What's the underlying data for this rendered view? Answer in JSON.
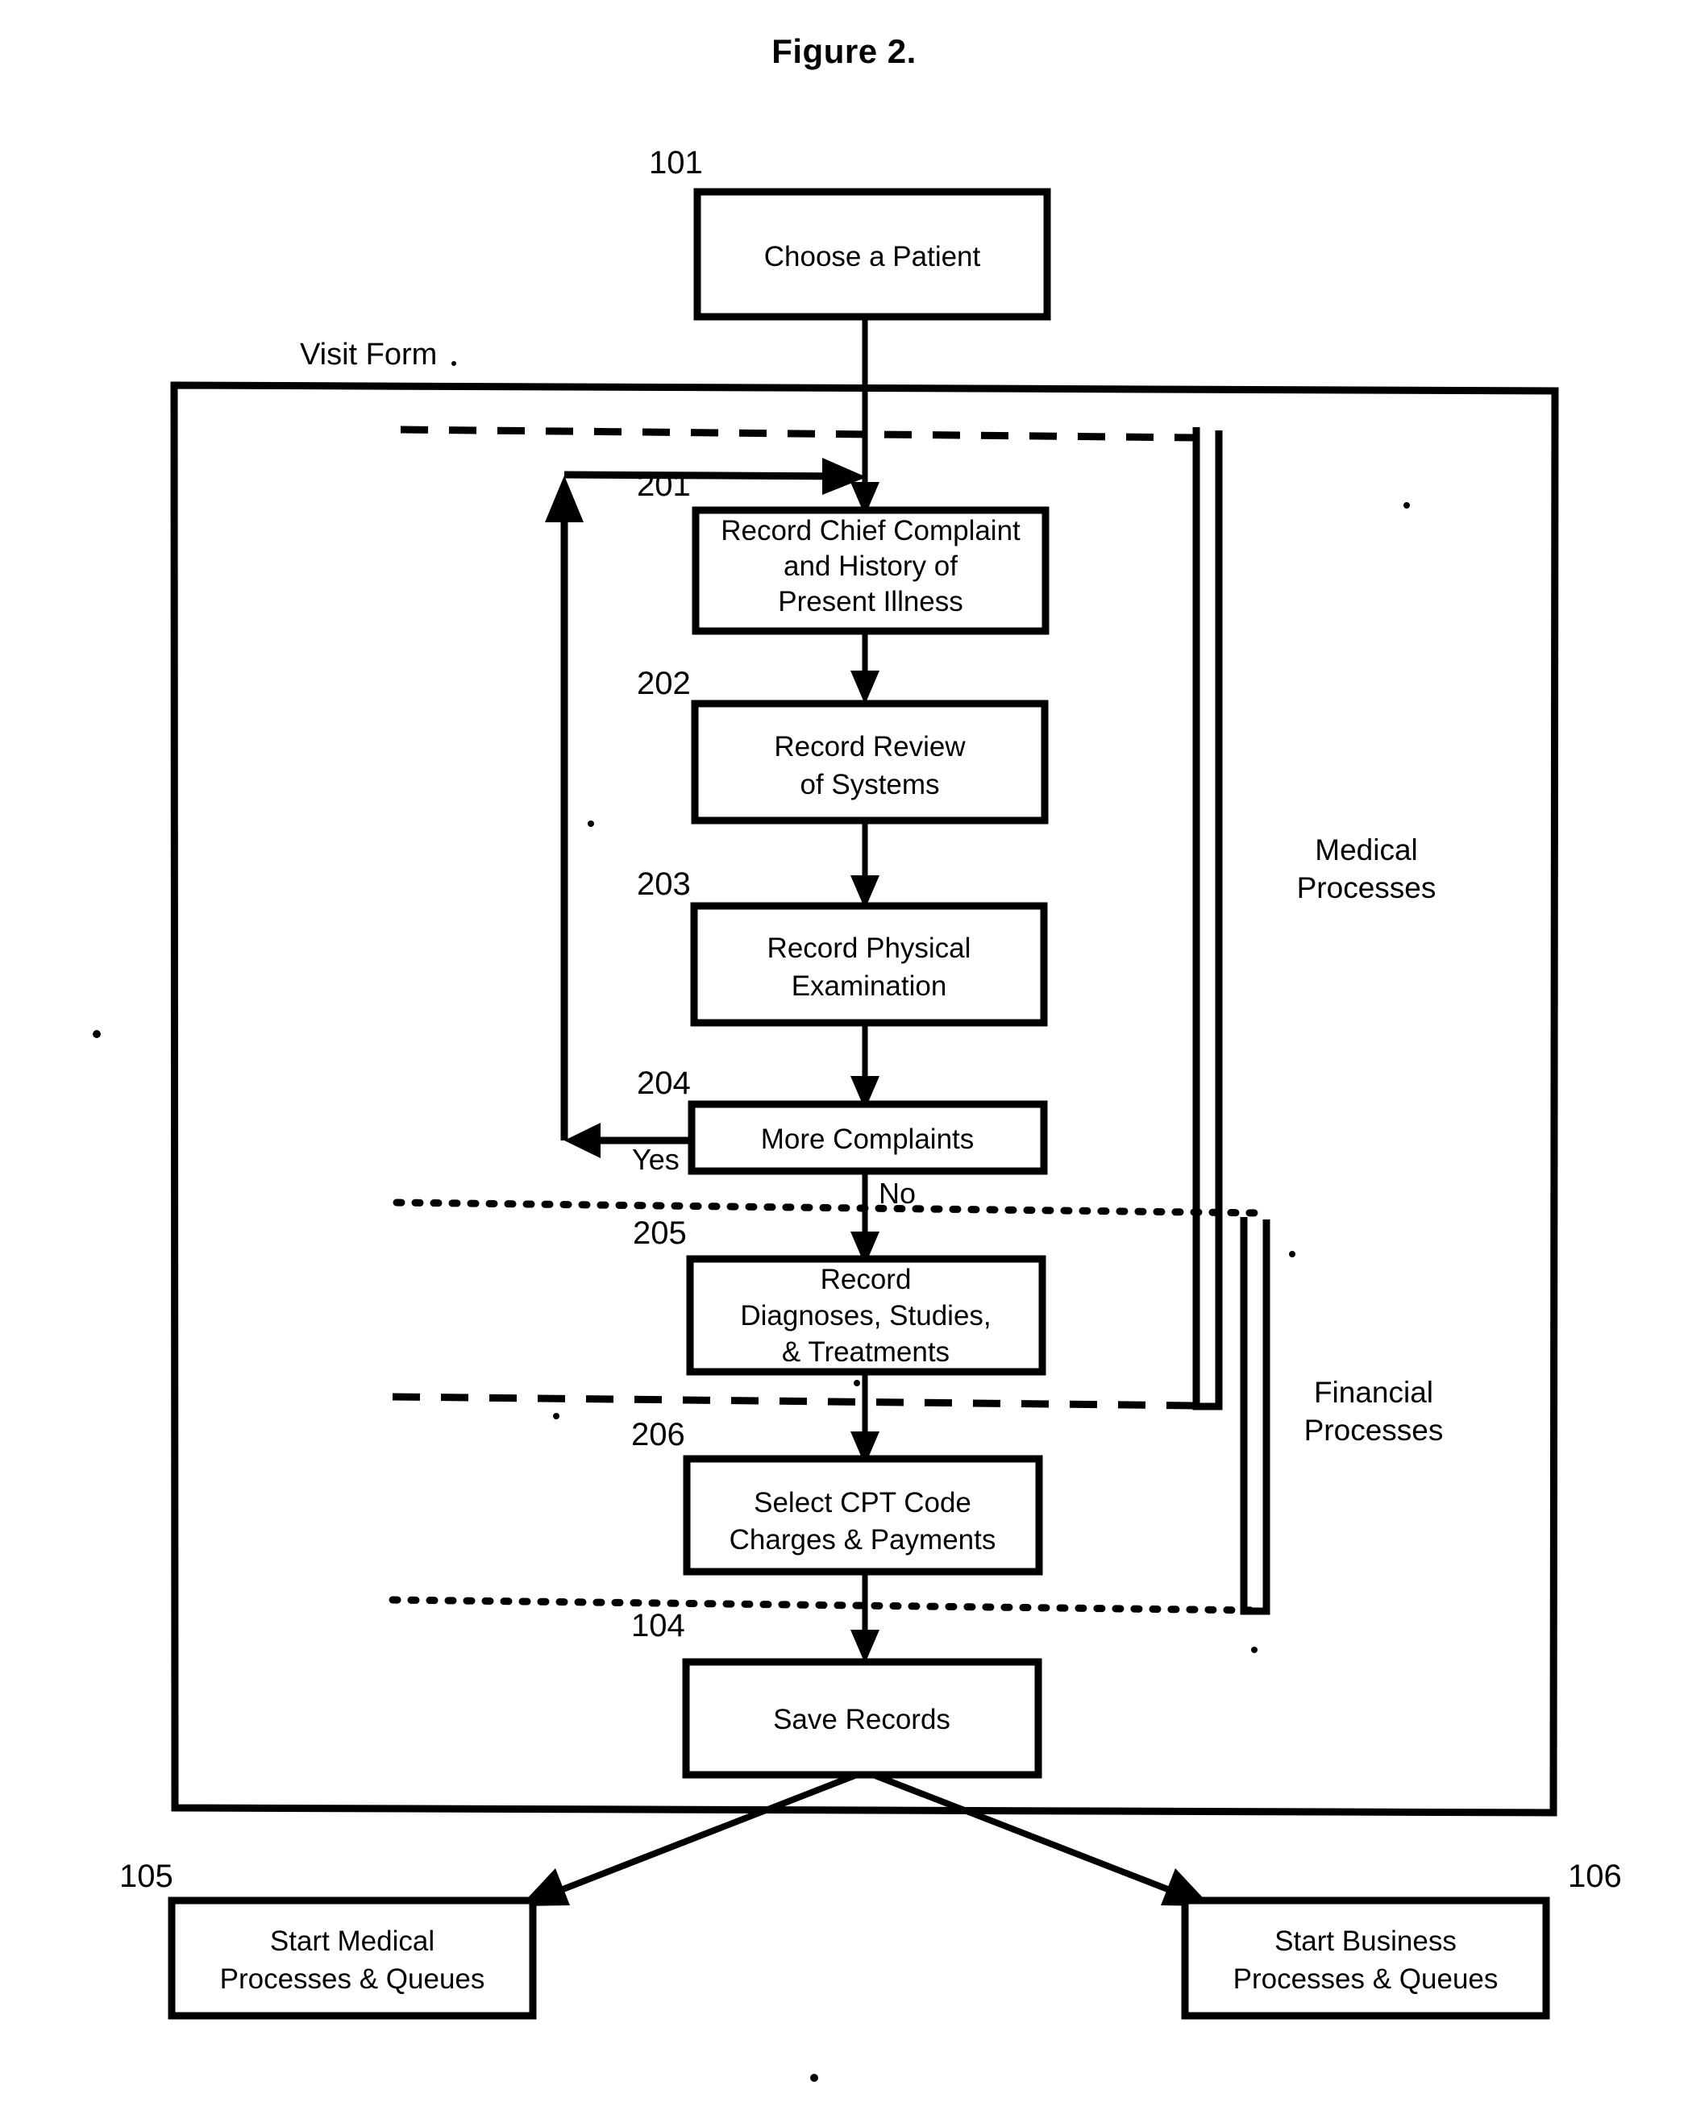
{
  "figure": {
    "title": "Figure 2."
  },
  "container": {
    "label": "Visit Form"
  },
  "swimlanes": [
    {
      "id": "medical",
      "label_line1": "Medical",
      "label_line2": "Processes"
    },
    {
      "id": "financial",
      "label_line1": "Financial",
      "label_line2": "Processes"
    }
  ],
  "nodes": [
    {
      "ref": "101",
      "name": "choose-a-patient",
      "lines": [
        "Choose a Patient"
      ]
    },
    {
      "ref": "201",
      "name": "record-chief-complaint",
      "lines": [
        "Record Chief Complaint",
        "and History of",
        "Present Illness"
      ]
    },
    {
      "ref": "202",
      "name": "record-review-of-systems",
      "lines": [
        "Record Review",
        "of Systems"
      ]
    },
    {
      "ref": "203",
      "name": "record-physical-examination",
      "lines": [
        "Record Physical",
        "Examination"
      ]
    },
    {
      "ref": "204",
      "name": "more-complaints",
      "lines": [
        "More Complaints"
      ]
    },
    {
      "ref": "205",
      "name": "record-diagnoses-studies-treatments",
      "lines": [
        "Record",
        "Diagnoses, Studies,",
        "& Treatments"
      ]
    },
    {
      "ref": "206",
      "name": "select-cpt-code-charges-payments",
      "lines": [
        "Select CPT Code",
        "Charges & Payments"
      ]
    },
    {
      "ref": "104",
      "name": "save-records",
      "lines": [
        "Save Records"
      ]
    },
    {
      "ref": "105",
      "name": "start-medical-processes-queues",
      "lines": [
        "Start Medical",
        "Processes & Queues"
      ]
    },
    {
      "ref": "106",
      "name": "start-business-processes-queues",
      "lines": [
        "Start Business",
        "Processes & Queues"
      ]
    }
  ],
  "edge_labels": {
    "yes": "Yes",
    "no": "No"
  },
  "colors": {
    "stroke": "#000000",
    "background": "#ffffff"
  }
}
